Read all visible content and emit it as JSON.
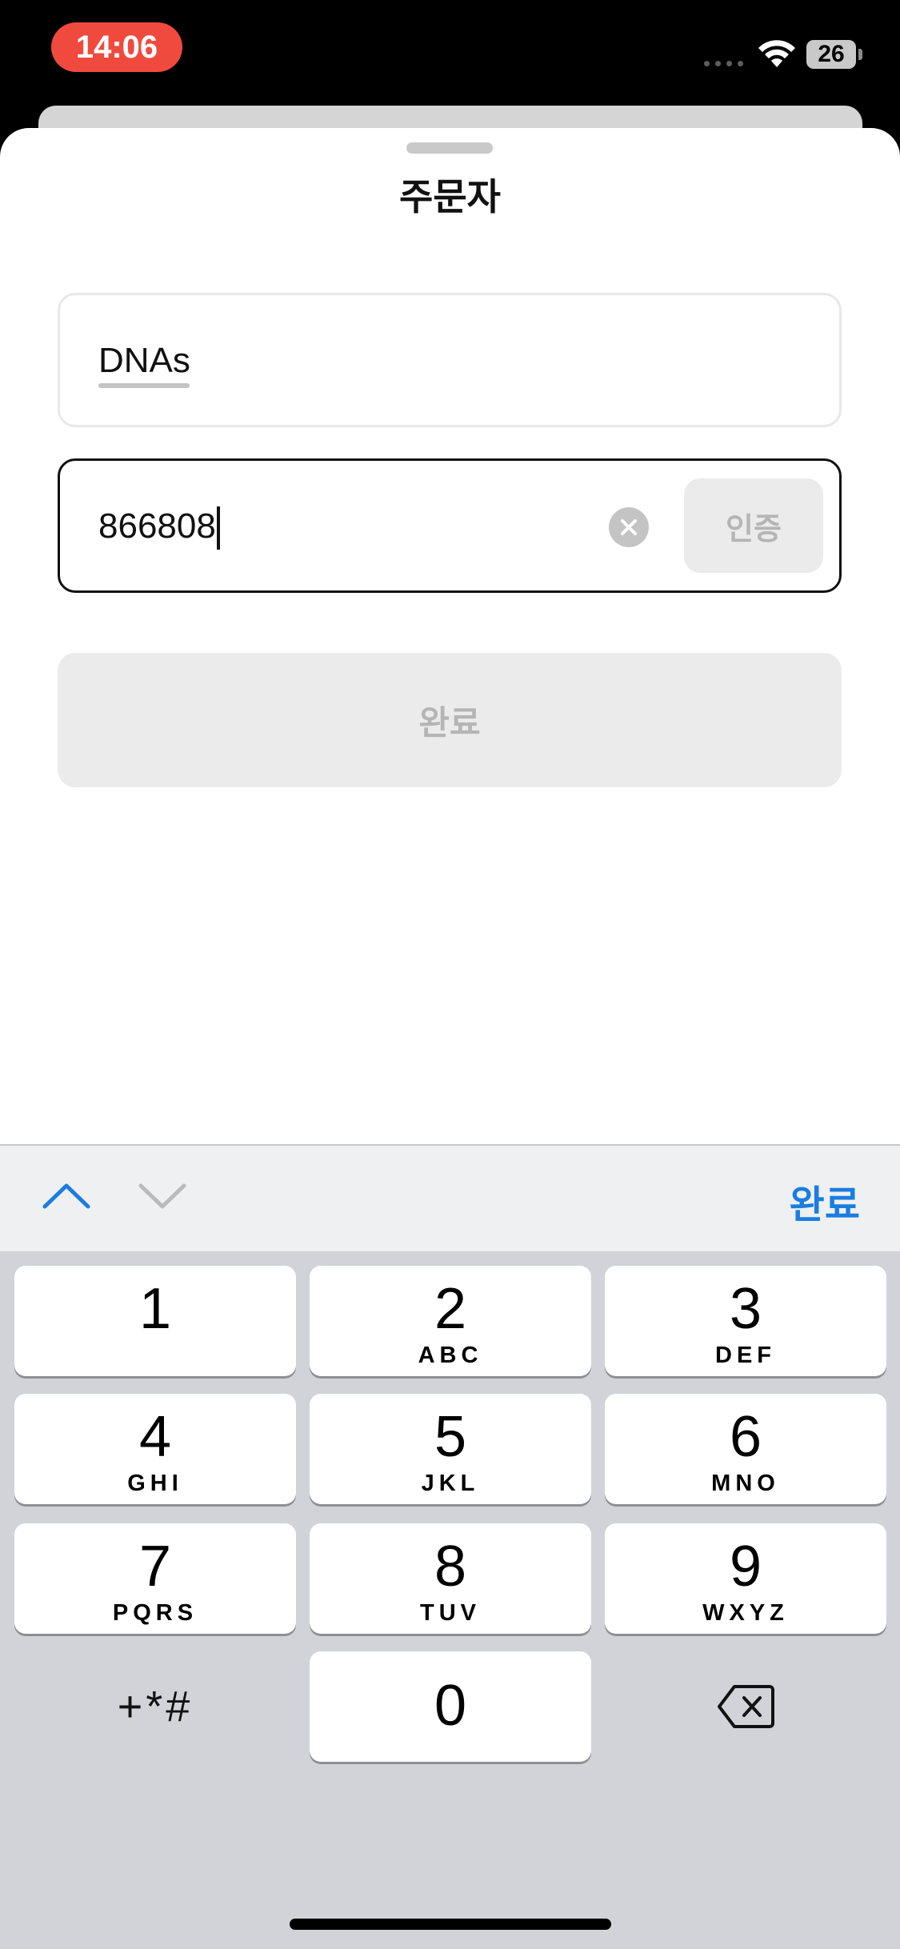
{
  "status_bar": {
    "time": "14:06",
    "battery": "26"
  },
  "sheet": {
    "title": "주문자"
  },
  "form": {
    "name_value": "DNAs",
    "phone_value": "866808",
    "verify_label": "인증",
    "submit_label": "완료"
  },
  "keyboard": {
    "done_label": "완료",
    "keys": [
      {
        "num": "1",
        "letters": ""
      },
      {
        "num": "2",
        "letters": "ABC"
      },
      {
        "num": "3",
        "letters": "DEF"
      },
      {
        "num": "4",
        "letters": "GHI"
      },
      {
        "num": "5",
        "letters": "JKL"
      },
      {
        "num": "6",
        "letters": "MNO"
      },
      {
        "num": "7",
        "letters": "PQRS"
      },
      {
        "num": "8",
        "letters": "TUV"
      },
      {
        "num": "9",
        "letters": "WXYZ"
      }
    ],
    "symbols_label": "+*#",
    "zero": "0"
  }
}
